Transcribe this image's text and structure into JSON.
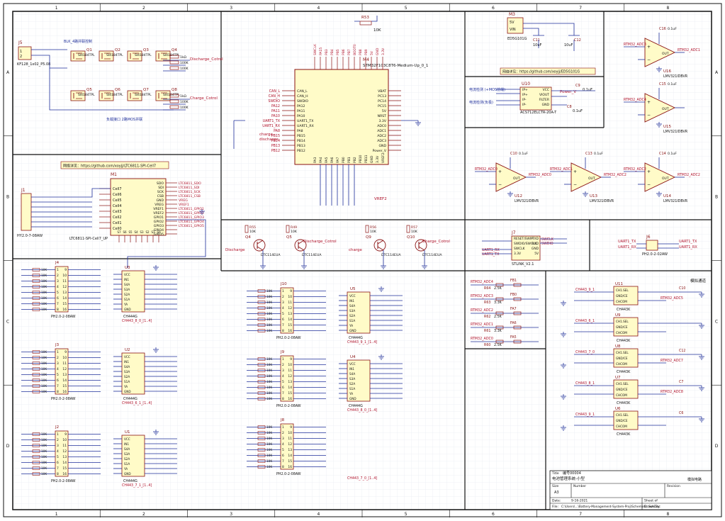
{
  "frame": {
    "columns": [
      "1",
      "2",
      "3",
      "4",
      "5",
      "6",
      "7",
      "8"
    ],
    "rows": [
      "A",
      "B",
      "C",
      "D"
    ]
  },
  "colors": {
    "border": "#111111",
    "wire": "#1f2f9a",
    "part": "#8a1212",
    "body_fill": "#fffbc8",
    "net": "#b0132b",
    "grid": "#cfd6e3",
    "power": "#b0132b",
    "link": "#1f2f9a"
  },
  "blocks": {
    "bms_switch": {
      "ref": "J5",
      "connector": "KF128_1x02_P5.08",
      "q_refs": [
        "Q1",
        "Q2",
        "Q3",
        "Q4",
        "Q5",
        "Q6",
        "Q7",
        "Q8"
      ],
      "mos_part": "SI4184TPL",
      "net_discharge": "Discharge_Cotrol",
      "net_charge": "Charge_Cotrol",
      "res_1": "1kΩ",
      "res_2": "100K",
      "note_top": "BLK_4路并联控制",
      "note_bottom": "负载接口 2路MOS并联"
    },
    "mcu": {
      "ref": "M4",
      "part": "STM32F103C8T6-Medium-Up_0_1",
      "left_pins": [
        "CAN_L",
        "CAN_H",
        "SWDIO",
        "PA12",
        "PA11",
        "PA10",
        "UART1_TX",
        "UART1_RX",
        "PA8",
        "PB15",
        "PB14",
        "PB13",
        "PB12"
      ],
      "right_pins": [
        "VBAT",
        "PC13",
        "PC14",
        "PC15",
        "5V",
        "NRST",
        "3.3V",
        "ADC0",
        "ADC1",
        "ADC2",
        "ADC3",
        "GND",
        "Power_V"
      ],
      "top_pins": [
        "SWCLK",
        "PA15",
        "PB3",
        "PB4",
        "PB5",
        "PB6",
        "PB7",
        "BOOT0",
        "PB8",
        "PB9",
        "5V",
        "GND",
        "3.3V"
      ],
      "bottom_pins": [
        "PA3",
        "PA4",
        "PA5",
        "PA6",
        "PA7",
        "PB0",
        "PB1",
        "PB2",
        "PB10",
        "PB11",
        "GND",
        "3.3V",
        "VREF2"
      ],
      "r_ref": "R53",
      "r_val": "10K",
      "nets": [
        "charge",
        "discharge",
        "VREF2",
        "5V",
        "GND"
      ]
    },
    "ldo": {
      "ref": "M3",
      "part": "ED5G101G",
      "pins": [
        "5V",
        "VIN",
        "GND",
        "VOUT"
      ],
      "caps": [
        "C11",
        "C12"
      ],
      "cap_vals": [
        "10uF",
        "10uF"
      ],
      "link_text": "网络详见：https://github.com/xoyjj/ED5G101G"
    },
    "current_sensor": {
      "ref": "U10",
      "part": "ACS712ELCTR-20A-T",
      "pins": [
        "IP+",
        "IP+",
        "IP-",
        "IP-",
        "VCC",
        "VIOUT",
        "FILTER",
        "GND"
      ],
      "caps": [
        "C9",
        "C8"
      ],
      "cap_vals": [
        "0.1uF",
        "0.1uF"
      ],
      "in_note": "电流检测 (+MOS前端)",
      "out_note": "电流检测(负极)",
      "net": "Power_V"
    },
    "opamps": [
      {
        "ref": "U16",
        "part": "LMV321IDBVR",
        "in": "RTM32_ADC3",
        "out": "RTM32_ADC1",
        "cap": "C16",
        "cap_val": "0.1uF"
      },
      {
        "ref": "U15",
        "part": "LMV321IDBVR",
        "in": "RTM32_ADC4",
        "out": "",
        "cap": "C15",
        "cap_val": "0.1uF"
      },
      {
        "ref": "U12",
        "part": "LMV321IDBVR",
        "in": "RTM32_ADC0",
        "out": "RTM32_ADC0",
        "cap": "C10",
        "cap_val": "0.1uF"
      },
      {
        "ref": "U13",
        "part": "LMV321IDBVR",
        "in": "RTM32_ADC1",
        "out": "RTM32_ADC2",
        "cap": "C13",
        "cap_val": "0.1uF"
      },
      {
        "ref": "U14",
        "part": "LMV321IDBVR",
        "in": "RTM32_ADC2",
        "out": "RTM32_ADC2",
        "cap": "C14",
        "cap_val": "0.1uF"
      }
    ],
    "afe": {
      "ref": "M1",
      "part": "LTC6811-SPI-Cell7_UP",
      "link_text": "网络详见：https://github.com/xoyjj/LTC6811-SPI-Cell7",
      "left_pins": [
        "Cell7",
        "Cell6",
        "Cell5",
        "Cell4",
        "Cell3",
        "Cell2",
        "Cell1",
        "Cell0"
      ],
      "right_pins": [
        "SDO",
        "SDI",
        "SCK",
        "CSB",
        "GND",
        "VREG",
        "VREF1",
        "VREF2",
        "GPIO1",
        "GPIO2",
        "GPIO3",
        "GPIO4",
        "GPIO5"
      ],
      "bottom_pins": [
        "S7",
        "S6",
        "S5",
        "S4",
        "S3",
        "S2",
        "S1",
        "S0"
      ],
      "connector": "J1",
      "connector_part": "HY2.0-7-08AW",
      "nets": [
        "LTC6811_SDO",
        "LTC6811_SDI",
        "LTC6811_SCK",
        "LTC6811_CSB",
        "VREG",
        "VREF1",
        "LTC6811_GPIO1",
        "LTC6811_GPIO2",
        "LTC6811_GPIO3",
        "LTC6811_GPIO4",
        "LTC6811_GPIO5"
      ]
    },
    "drivers": {
      "q_refs": [
        "Q4",
        "Q5",
        "Q9",
        "Q10"
      ],
      "part": "DTC114EUA",
      "r_vals": [
        "10K",
        "10K",
        "10K",
        "10K"
      ],
      "r_refs": [
        "R55",
        "R49",
        "R56",
        "R57"
      ],
      "nets": [
        "Discharge",
        "Discharge_Cotrol",
        "charge",
        "Charge_Cotrol"
      ]
    },
    "swd": {
      "ref": "J7",
      "part": "STLINK_V2.1",
      "pins": [
        "RESET/SWIM",
        "SWDIO/SWCLK",
        "SWCLK",
        "3.3V",
        "TXD",
        "RXD",
        "GND",
        "5V"
      ],
      "nets": [
        "SWCLK",
        "SWDIO",
        "UART1_RX",
        "UART1_TX"
      ]
    },
    "uart": {
      "ref": "J6",
      "part": "PH2.0-2-02AW",
      "nets": [
        "UART1_TX",
        "UART1_RX"
      ]
    },
    "adc_filter": {
      "refs": [
        "R64",
        "R63",
        "R62",
        "R61",
        "R60"
      ],
      "vals": [
        "2.5K",
        "3.3K",
        "2.5K",
        "3.3K",
        "2.5K"
      ],
      "caps": [
        "FB1",
        "FB0",
        "FA7",
        "FA6",
        "FA5"
      ],
      "nets": [
        "RTM32_ADC4",
        "RTM32_ADC3",
        "RTM32_ADC2",
        "RTM32_ADC1",
        "RTM32_ADC0"
      ]
    },
    "mux_left": [
      {
        "conn": "J4",
        "conn_part": "PH2.0-2-08AW",
        "ic": "U3",
        "ic_part": "CH444G",
        "tag": "CH443_8_0_[1..4]",
        "res": "10K"
      },
      {
        "conn": "J3",
        "conn_part": "PH2.0-2-08AW",
        "ic": "U2",
        "ic_part": "CH444G",
        "tag": "CH443_6_1_[1..4]",
        "res": "10K"
      },
      {
        "conn": "J2",
        "conn_part": "PH2.0-2-08AW",
        "ic": "U1",
        "ic_part": "CH444G",
        "tag": "CH443_7_1_[1..4]",
        "res": "10K"
      }
    ],
    "mux_mid": [
      {
        "conn": "J10",
        "conn_part": "PH2.0-2-08AW",
        "ic": "U5",
        "ic_part": "CH444G",
        "tag": "CH443_9_1_[1..4]",
        "res": "10K"
      },
      {
        "conn": "J9",
        "conn_part": "PH2.0-2-08AW",
        "ic": "U4",
        "ic_part": "CH444G",
        "tag": "CH443_8_0_[1..4]",
        "res": "10K"
      },
      {
        "conn": "J8",
        "conn_part": "PH2.0-2-08AW",
        "ic": "",
        "ic_part": "",
        "tag": "CH443_7_0_[1..4]",
        "res": "10K"
      }
    ],
    "mux_right": [
      {
        "ic": "U11",
        "part": "CH443K",
        "in": "CH443_9_1",
        "out": "RTM32_ADC5",
        "cap": "C10"
      },
      {
        "ic": "U9",
        "part": "CH443K",
        "in": "CH443_6_1",
        "out": "",
        "cap": ""
      },
      {
        "ic": "U8",
        "part": "CH443K",
        "in": "CH443_7_0",
        "out": "RTM32_ADC7",
        "cap": "C12"
      },
      {
        "ic": "U7",
        "part": "CH443K",
        "in": "CH443_8_1",
        "out": "RTM32_ADC8",
        "cap": "C7"
      },
      {
        "ic": "U6",
        "part": "CH443K",
        "in": "CH443_9_1",
        "out": "",
        "cap": "C6"
      }
    ],
    "right_note": "模拟通道"
  },
  "title_block": {
    "title_label": "Title",
    "title": "电池管理系统-小型",
    "title_code": "编号00004",
    "size_label": "Size",
    "size": "A3",
    "number_label": "Number",
    "revision_label": "Revision",
    "date_label": "Date:",
    "date": "9-16-2021",
    "sheet_label": "Sheet  of",
    "file_label": "File:",
    "file": "C:\\Users\\...\\Battery-Management-System-Proj\\Schematic.SchDoc",
    "drawn_label": "Drawn By:",
    "stamp": "模拟电路"
  }
}
